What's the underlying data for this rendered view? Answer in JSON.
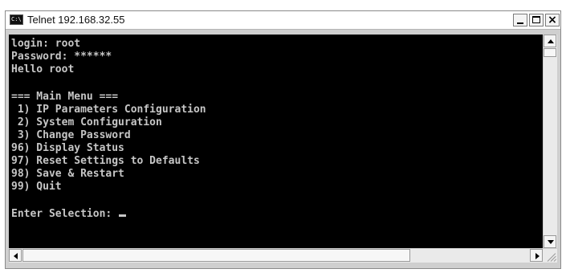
{
  "window": {
    "title": "Telnet 192.168.32.55",
    "icon": "console-icon",
    "icon_text": "C:\\",
    "controls": {
      "minimize": "minimize-icon",
      "maximize": "maximize-icon",
      "close": "×"
    }
  },
  "console": {
    "login": "login: root",
    "password": "Password: ******",
    "greeting": "Hello root",
    "menu_header": "=== Main Menu ===",
    "menu_items": [
      " 1) IP Parameters Configuration",
      " 2) System Configuration",
      " 3) Change Password",
      "96) Display Status",
      "97) Reset Settings to Defaults",
      "98) Save & Restart",
      "99) Quit"
    ],
    "prompt": "Enter Selection: "
  },
  "colors": {
    "console_background": "#000000",
    "console_text": "#c6c6c6",
    "titlebar": "#ffffff",
    "frame": "#cfcfcf"
  }
}
